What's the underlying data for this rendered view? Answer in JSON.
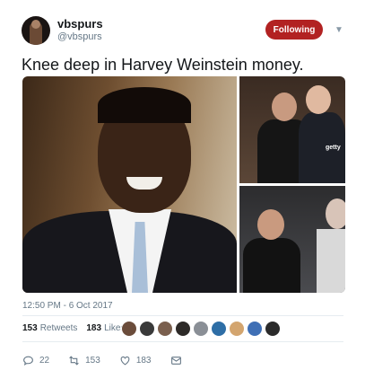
{
  "user": {
    "display_name": "vbspurs",
    "handle": "@vbspurs"
  },
  "follow_button_label": "Following",
  "tweet": {
    "text": "Knee deep in Harvey Weinstein money.",
    "timestamp": "12:50 PM - 6 Oct 2017",
    "image_watermark": "getty"
  },
  "stats": {
    "retweets_count": "153",
    "retweets_label": "Retweets",
    "likes_count": "183",
    "likes_label": "Likes"
  },
  "actions": {
    "reply_count": "22",
    "retweet_count": "153",
    "like_count": "183"
  },
  "likers_colors": [
    "#6b4c3b",
    "#3a3a3a",
    "#7a5f4e",
    "#2d2a28",
    "#8a8f96",
    "#2e6ea6",
    "#d3a56f",
    "#3f6fb5",
    "#2b2b2b"
  ],
  "icons": {
    "menu": "chevron-down-icon",
    "reply": "reply-icon",
    "retweet": "retweet-icon",
    "like": "heart-icon",
    "message": "envelope-icon"
  }
}
